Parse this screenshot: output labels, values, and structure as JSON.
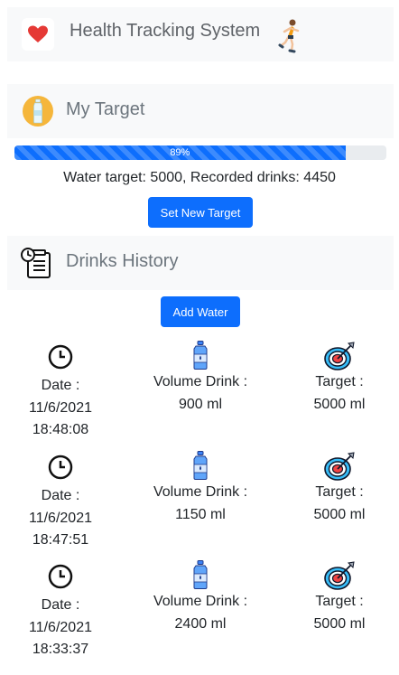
{
  "app": {
    "title": "Health Tracking System",
    "logo_icon": "heart-icon",
    "mascot_icon": "runner-icon"
  },
  "target": {
    "heading": "My Target",
    "icon": "water-bottle-icon",
    "progress": {
      "percent": 89,
      "label": "89%"
    },
    "summary": "Water target: 5000, Recorded drinks: 4450",
    "set_button": "Set New Target"
  },
  "history": {
    "heading": "Drinks History",
    "icon": "clipboard-clock-icon",
    "add_button": "Add Water",
    "date_label": "Date :",
    "volume_label": "Volume Drink :",
    "target_label": "Target :",
    "records": [
      {
        "date": "11/6/2021",
        "time": "18:48:08",
        "volume": "900 ml",
        "target": "5000 ml"
      },
      {
        "date": "11/6/2021",
        "time": "18:47:51",
        "volume": "1150 ml",
        "target": "5000 ml"
      },
      {
        "date": "11/6/2021",
        "time": "18:33:37",
        "volume": "2400 ml",
        "target": "5000 ml"
      }
    ]
  },
  "colors": {
    "primary": "#0d6efd",
    "panel": "#f8f9fa",
    "heart": "#e53935",
    "bottle_circle": "#f5b63b"
  }
}
